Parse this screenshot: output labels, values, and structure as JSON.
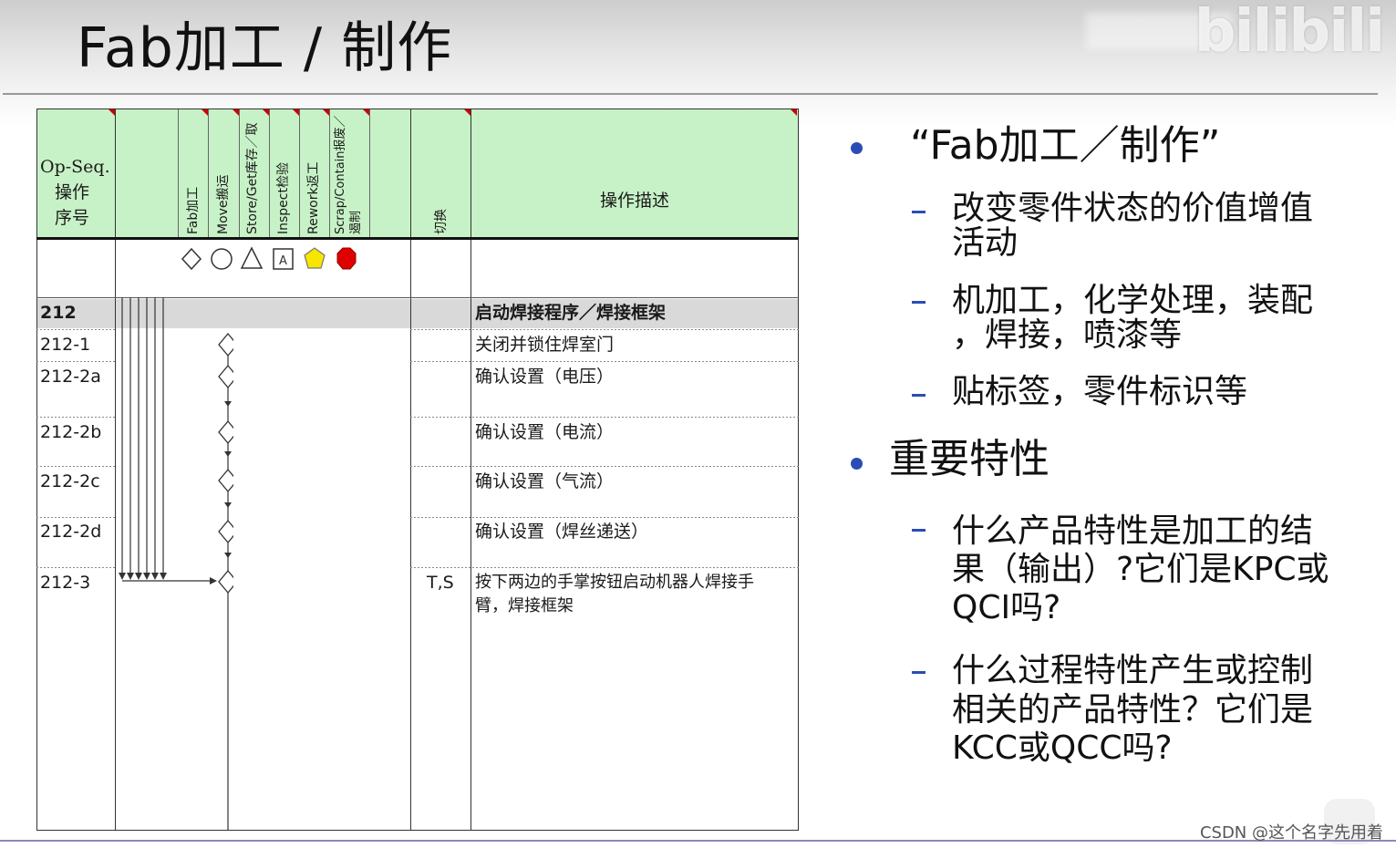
{
  "slide": {
    "title": "Fab加工 / 制作",
    "watermark": "bilibili",
    "footer_credit": "CSDN @这个名字先用着"
  },
  "table": {
    "header": {
      "op_seq": [
        "Op-Seq.",
        "操作",
        "序号"
      ],
      "columns": [
        "Fab加工",
        "Move搬运",
        "Store/Get库存／取",
        "Inspect检验",
        "Rework返工",
        "Scrap/Contain报废／遏制"
      ],
      "switch": "切换",
      "description": "操作描述"
    },
    "symbols": [
      "diamond-icon",
      "circle-icon",
      "triangle-icon",
      "square-a-icon",
      "pentagon-icon",
      "octagon-icon"
    ],
    "symbol_square_letter": "A",
    "colors": {
      "header_bg": "#c7f2c7",
      "group_row_bg": "#d9d9d9",
      "pentagon": "#f7e600",
      "octagon": "#e00000",
      "bullet": "#2a4db5"
    },
    "rows": [
      {
        "op": "212",
        "switch": "",
        "desc": "启动焊接程序／焊接框架"
      },
      {
        "op": "212-1",
        "switch": "",
        "desc": "关闭并锁住焊室门"
      },
      {
        "op": "212-2a",
        "switch": "",
        "desc": "确认设置（电压）"
      },
      {
        "op": "212-2b",
        "switch": "",
        "desc": "确认设置（电流）"
      },
      {
        "op": "212-2c",
        "switch": "",
        "desc": "确认设置（气流）"
      },
      {
        "op": "212-2d",
        "switch": "",
        "desc": "确认设置（焊丝递送）"
      },
      {
        "op": "212-3",
        "switch": "T,S",
        "desc_line1": "按下两边的手掌按钮启动机器人焊接手",
        "desc_line2": "臂，焊接框架"
      }
    ]
  },
  "bullets": {
    "b1": {
      "heading": "“Fab加工／制作”",
      "items": [
        {
          "line1": "改变零件状态的价值增值",
          "line2": "活动"
        },
        {
          "line1": "机加工，化学处理，装配",
          "line2": "，焊接，喷漆等"
        },
        {
          "line1": "贴标签，零件标识等"
        }
      ]
    },
    "b2": {
      "heading": "重要特性",
      "items": [
        {
          "line1": "什么产品特性是加工的结",
          "line2": "果（输出）?它们是KPC或",
          "line3": "QCI吗?"
        },
        {
          "line1": "什么过程特性产生或控制",
          "line2": "相关的产品特性？它们是",
          "line3": "KCC或QCC吗?"
        }
      ]
    }
  }
}
